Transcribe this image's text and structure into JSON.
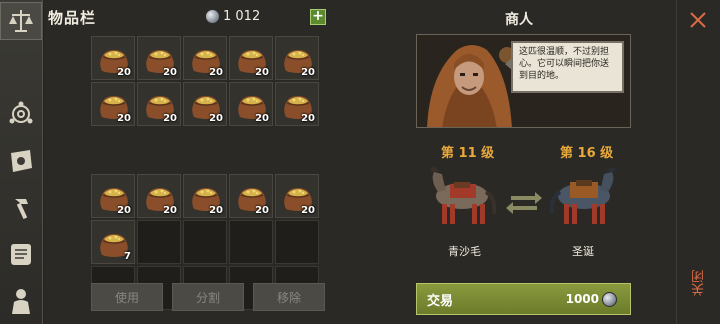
{
  "sidebar": {
    "items": [
      {
        "icon": "scales-icon",
        "active": true
      },
      {
        "icon": "compass-icon",
        "active": false
      },
      {
        "icon": "sun-map-icon",
        "active": false
      },
      {
        "icon": "hammer-icon",
        "active": false
      },
      {
        "icon": "scroll-icon",
        "active": false
      },
      {
        "icon": "character-icon",
        "active": false
      }
    ]
  },
  "inventory": {
    "title": "物品栏",
    "gems": "1 012",
    "add_label": "+",
    "slots": [
      {
        "qty": "20"
      },
      {
        "qty": "20"
      },
      {
        "qty": "20"
      },
      {
        "qty": "20"
      },
      {
        "qty": "20"
      },
      {
        "qty": "20"
      },
      {
        "qty": "20"
      },
      {
        "qty": "20"
      },
      {
        "qty": "20"
      },
      {
        "qty": "20"
      },
      {
        "qty": "20"
      },
      {
        "qty": "20"
      },
      {
        "qty": "20"
      },
      {
        "qty": "20"
      },
      {
        "qty": "20"
      },
      {
        "qty": "7"
      },
      null,
      null,
      null,
      null,
      null,
      null,
      null,
      null,
      null
    ],
    "buttons": {
      "use": "使用",
      "split": "分割",
      "remove": "移除"
    }
  },
  "merchant": {
    "title": "商人",
    "dialogue": "这匹很温顺，不过别担心。它可以瞬间把你送到目的地。",
    "left_horse": {
      "level": "第 11 级",
      "name": "青沙毛"
    },
    "right_horse": {
      "level": "第 16 级",
      "name": "圣诞"
    },
    "trade": {
      "label": "交易",
      "price": "1000"
    }
  },
  "close": {
    "label": "关闭"
  },
  "colors": {
    "accent": "#e9a93a",
    "trade": "#7a8c34",
    "close": "#d96a43"
  }
}
